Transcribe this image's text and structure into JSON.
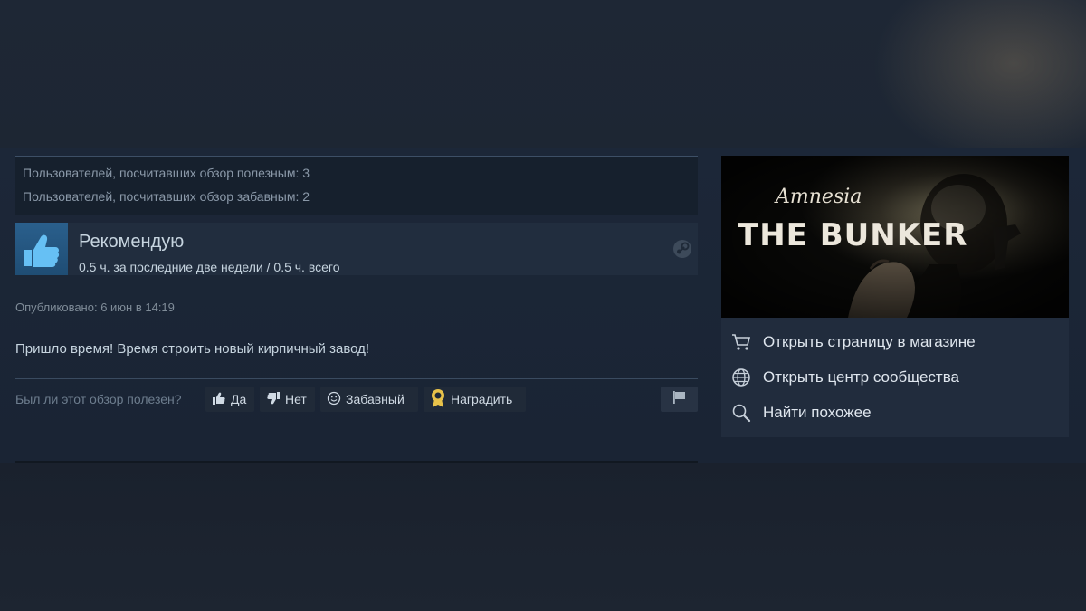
{
  "review": {
    "votes": {
      "helpful": "Пользователей, посчитавших обзор полезным: 3",
      "funny": "Пользователей, посчитавших обзор забавным: 2"
    },
    "recommendation": {
      "label": "Рекомендую",
      "hours": "0.5 ч. за последние две недели / 0.5 ч. всего"
    },
    "posted": "Опубликовано: 6 июн в 14:19",
    "text": "Пришло время! Время строить новый кирпичный завод!",
    "feedback": {
      "question": "Был ли этот обзор полезен?",
      "yes": "Да",
      "no": "Нет",
      "funny": "Забавный",
      "award": "Наградить"
    }
  },
  "game": {
    "logo_top": "Amnesia",
    "logo_bottom": "THE BUNKER",
    "links": {
      "store": "Открыть страницу в магазине",
      "community": "Открыть центр сообщества",
      "similar": "Найти похожее"
    }
  },
  "colors": {
    "accent": "#2a5f8c",
    "award": "#e8c24a",
    "text": "#c6d4df"
  }
}
